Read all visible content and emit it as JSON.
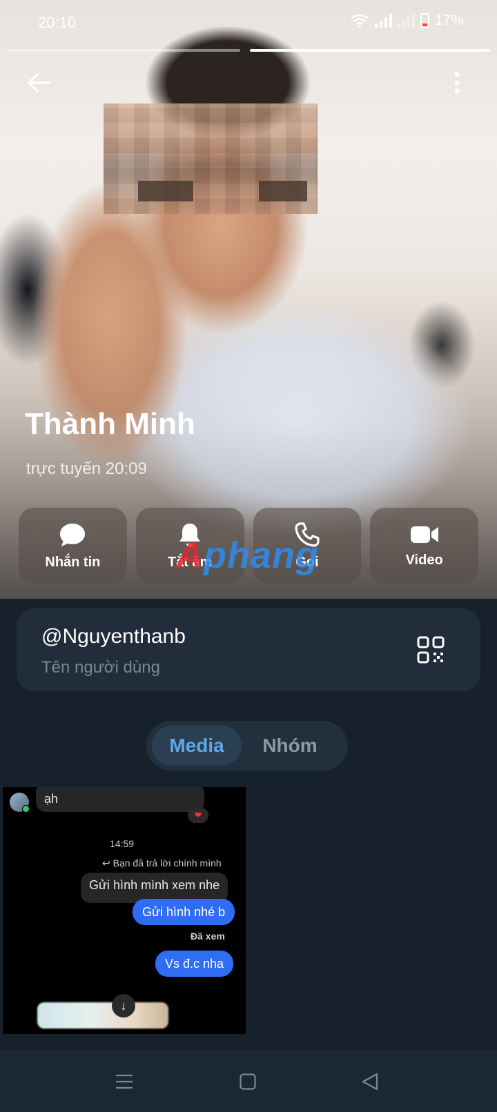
{
  "status_bar": {
    "time": "20:10",
    "battery": "17%",
    "icons": [
      "wifi-icon",
      "signal-icon",
      "signal-nosim-icon",
      "battery-icon"
    ]
  },
  "story_progress": {
    "segments": 2,
    "active_index": 1
  },
  "header": {
    "back_icon": "arrow-left-icon",
    "menu_icon": "more-vertical-icon"
  },
  "profile": {
    "name": "Thành Minh",
    "last_seen": "trực tuyến 20:09"
  },
  "actions": [
    {
      "label": "Nhắn tin",
      "icon": "message-bubble-icon"
    },
    {
      "label": "Tắt âm",
      "icon": "bell-icon"
    },
    {
      "label": "Gọi",
      "icon": "phone-icon"
    },
    {
      "label": "Video",
      "icon": "video-camera-icon"
    }
  ],
  "watermark": {
    "prefix": "A",
    "rest": "phang"
  },
  "username_card": {
    "username": "@Nguyenthanb",
    "caption": "Tên người dùng",
    "icon": "qr-code-icon"
  },
  "tabs": [
    {
      "label": "Media",
      "active": true
    },
    {
      "label": "Nhóm",
      "active": false
    }
  ],
  "media_thumbnail": {
    "incoming_text": "ạh",
    "time": "14:59",
    "reply_note": "↩ Bạn đã trả lời chính mình",
    "quoted": "Gửi hình mình xem nhe",
    "outgoing_1": "Gửi hình nhé b",
    "seen": "Đã xem",
    "outgoing_2": "Vs đ.c nha"
  },
  "nav_bar": {
    "icons": [
      "menu-lines-icon",
      "home-square-icon",
      "back-triangle-icon"
    ]
  },
  "colors": {
    "background": "#17212b",
    "card": "#212d3b",
    "accent": "#5fa9e8",
    "outgoing_bubble": "#2f6df5"
  }
}
